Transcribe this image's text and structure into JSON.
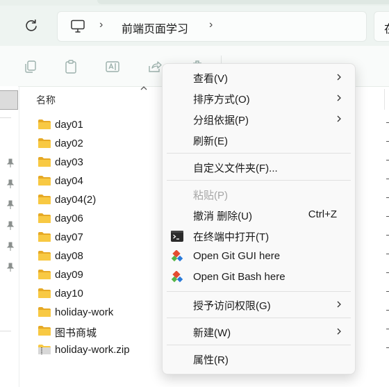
{
  "address": {
    "crumbs": [
      "前端页面学习"
    ],
    "search_glyph": "在"
  },
  "toolbar": {
    "icons": [
      "copy-icon",
      "paste-icon",
      "rename-icon",
      "share-icon",
      "delete-icon"
    ]
  },
  "file_list": {
    "column_name": "名称",
    "items": [
      {
        "name": "day01",
        "type": "folder"
      },
      {
        "name": "day02",
        "type": "folder"
      },
      {
        "name": "day03",
        "type": "folder"
      },
      {
        "name": "day04",
        "type": "folder"
      },
      {
        "name": "day04(2)",
        "type": "folder"
      },
      {
        "name": "day06",
        "type": "folder"
      },
      {
        "name": "day07",
        "type": "folder"
      },
      {
        "name": "day08",
        "type": "folder"
      },
      {
        "name": "day09",
        "type": "folder"
      },
      {
        "name": "day10",
        "type": "folder"
      },
      {
        "name": "holiday-work",
        "type": "folder"
      },
      {
        "name": "图书商城",
        "type": "folder"
      },
      {
        "name": "holiday-work.zip",
        "type": "zip"
      }
    ]
  },
  "context_menu": {
    "view": "查看(V)",
    "sort_by": "排序方式(O)",
    "group_by": "分组依据(P)",
    "refresh": "刷新(E)",
    "customize_folder": "自定义文件夹(F)...",
    "paste": "粘贴(P)",
    "undo_delete": "撤消 删除(U)",
    "undo_shortcut": "Ctrl+Z",
    "open_in_terminal": "在终端中打开(T)",
    "git_gui": "Open Git GUI here",
    "git_bash": "Open Git Bash here",
    "grant_access": "授予访问权限(G)",
    "new": "新建(W)",
    "properties": "属性(R)"
  },
  "colors": {
    "folder": "#f8c943",
    "folder_dark": "#e6a925",
    "git_red": "#e44c30",
    "git_green": "#55b447",
    "git_blue": "#2a7ad8"
  }
}
